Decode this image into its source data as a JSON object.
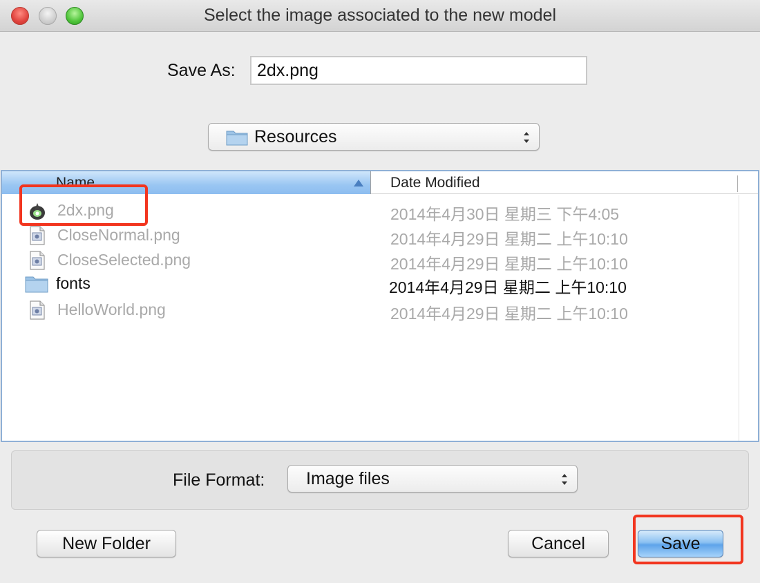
{
  "window": {
    "title": "Select the image associated to the new model"
  },
  "save_as": {
    "label": "Save As:",
    "value": "2dx.png"
  },
  "location": {
    "selected": "Resources",
    "icon": "folder-icon"
  },
  "file_list": {
    "columns": [
      "Name",
      "Date Modified"
    ],
    "sort_column": "Name",
    "sort_direction": "ascending",
    "rows": [
      {
        "name": "2dx.png",
        "date": "2014年4月30日 星期三 下午4:05",
        "icon": "app-image-icon",
        "enabled": false
      },
      {
        "name": "CloseNormal.png",
        "date": "2014年4月29日 星期二 上午10:10",
        "icon": "image-file-icon",
        "enabled": false
      },
      {
        "name": "CloseSelected.png",
        "date": "2014年4月29日 星期二 上午10:10",
        "icon": "image-file-icon",
        "enabled": false
      },
      {
        "name": "fonts",
        "date": "2014年4月29日 星期二 上午10:10",
        "icon": "folder-icon",
        "enabled": true
      },
      {
        "name": "HelloWorld.png",
        "date": "2014年4月29日 星期二 上午10:10",
        "icon": "image-file-icon",
        "enabled": false
      }
    ]
  },
  "file_format": {
    "label": "File Format:",
    "selected": "Image files"
  },
  "buttons": {
    "new_folder": "New Folder",
    "cancel": "Cancel",
    "save": "Save"
  },
  "colors": {
    "annotation": "#f2351f",
    "header_highlight": "#9ac6f2",
    "default_button": "#5ea4ea"
  }
}
